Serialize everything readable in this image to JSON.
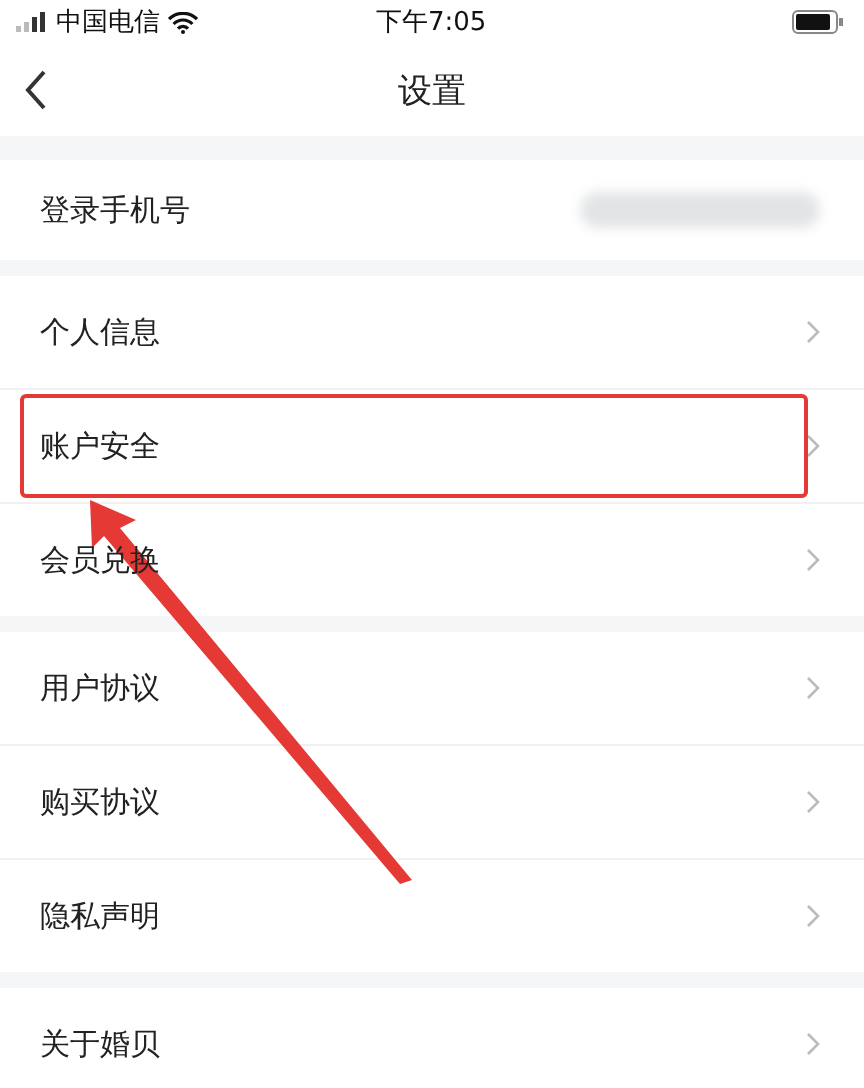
{
  "status_bar": {
    "carrier": "中国电信",
    "time": "下午7:05"
  },
  "nav": {
    "title": "设置"
  },
  "sections": [
    [
      {
        "label": "登录手机号",
        "kind": "masked",
        "highlighted": false
      }
    ],
    [
      {
        "label": "个人信息",
        "kind": "link",
        "highlighted": false
      },
      {
        "label": "账户安全",
        "kind": "link",
        "highlighted": true
      },
      {
        "label": "会员兑换",
        "kind": "link",
        "highlighted": false
      }
    ],
    [
      {
        "label": "用户协议",
        "kind": "link",
        "highlighted": false
      },
      {
        "label": "购买协议",
        "kind": "link",
        "highlighted": false
      },
      {
        "label": "隐私声明",
        "kind": "link",
        "highlighted": false
      }
    ],
    [
      {
        "label": "关于婚贝",
        "kind": "link",
        "highlighted": false
      }
    ]
  ]
}
